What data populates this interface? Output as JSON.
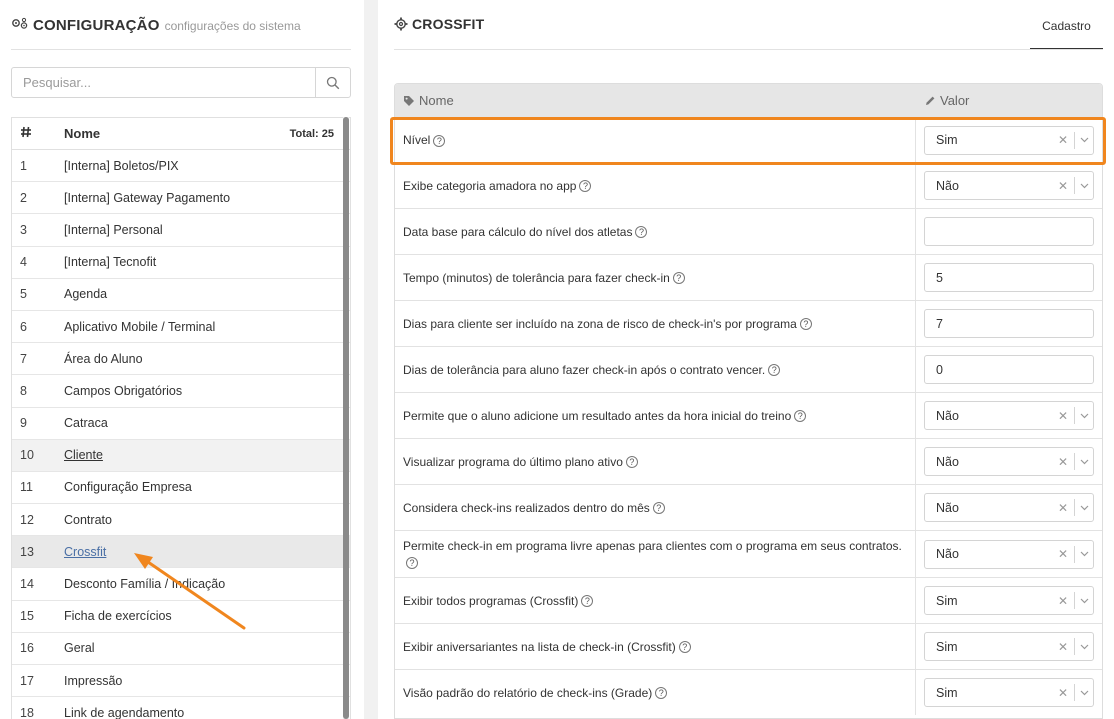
{
  "left": {
    "title": "CONFIGURAÇÃO",
    "subtitle": "configurações do sistema",
    "search_placeholder": "Pesquisar...",
    "table": {
      "col_icon": "#",
      "col_name": "Nome",
      "total": "Total: 25",
      "rows": [
        {
          "num": "1",
          "name": "[Interna] Boletos/PIX"
        },
        {
          "num": "2",
          "name": "[Interna] Gateway Pagamento"
        },
        {
          "num": "3",
          "name": "[Interna] Personal"
        },
        {
          "num": "4",
          "name": "[Interna] Tecnofit"
        },
        {
          "num": "5",
          "name": "Agenda"
        },
        {
          "num": "6",
          "name": "Aplicativo Mobile / Terminal"
        },
        {
          "num": "7",
          "name": "Área do Aluno"
        },
        {
          "num": "8",
          "name": "Campos Obrigatórios"
        },
        {
          "num": "9",
          "name": "Catraca"
        },
        {
          "num": "10",
          "name": "Cliente"
        },
        {
          "num": "11",
          "name": "Configuração Empresa"
        },
        {
          "num": "12",
          "name": "Contrato"
        },
        {
          "num": "13",
          "name": "Crossfit"
        },
        {
          "num": "14",
          "name": "Desconto Família / Indicação"
        },
        {
          "num": "15",
          "name": "Ficha de exercícios"
        },
        {
          "num": "16",
          "name": "Geral"
        },
        {
          "num": "17",
          "name": "Impressão"
        },
        {
          "num": "18",
          "name": "Link de agendamento"
        }
      ]
    }
  },
  "right": {
    "title": "CROSSFIT",
    "tab": "Cadastro",
    "col_name": "Nome",
    "col_value": "Valor",
    "rows": [
      {
        "label": "Nível",
        "type": "select",
        "value": "Sim"
      },
      {
        "label": "Exibe categoria amadora no app",
        "type": "select",
        "value": "Não"
      },
      {
        "label": "Data base para cálculo do nível dos atletas",
        "type": "input",
        "value": ""
      },
      {
        "label": "Tempo (minutos) de tolerância para fazer check-in",
        "type": "input",
        "value": "5"
      },
      {
        "label": "Dias para cliente ser incluído na zona de risco de check-in's por programa",
        "type": "input",
        "value": "7"
      },
      {
        "label": "Dias de tolerância para aluno fazer check-in após o contrato vencer.",
        "type": "input",
        "value": "0"
      },
      {
        "label": "Permite que o aluno adicione um resultado antes da hora inicial do treino",
        "type": "select",
        "value": "Não"
      },
      {
        "label": "Visualizar programa do último plano ativo",
        "type": "select",
        "value": "Não"
      },
      {
        "label": "Considera check-ins realizados dentro do mês",
        "type": "select",
        "value": "Não"
      },
      {
        "label": "Permite check-in em programa livre apenas para clientes com o programa em seus contratos.",
        "type": "select",
        "value": "Não"
      },
      {
        "label": "Exibir todos programas (Crossfit)",
        "type": "select",
        "value": "Sim"
      },
      {
        "label": "Exibir aniversariantes na lista de check-in (Crossfit)",
        "type": "select",
        "value": "Sim"
      },
      {
        "label": "Visão padrão do relatório de check-ins (Grade)",
        "type": "select",
        "value": "Sim"
      }
    ]
  },
  "colors": {
    "highlight": "#f0861e",
    "link_active": "#4a6fa5"
  }
}
